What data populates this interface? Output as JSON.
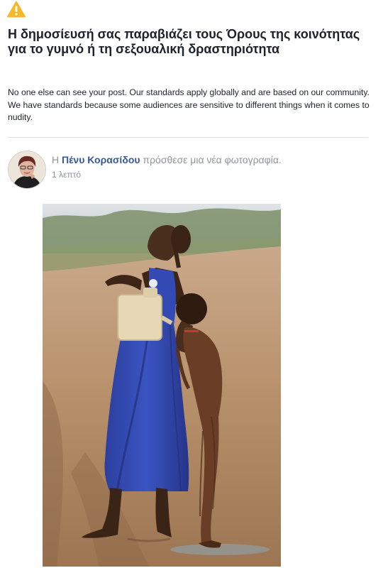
{
  "notice": {
    "icon": "warning-icon",
    "icon_color": "#f7b928",
    "title": "Η δημοσίευσή σας παραβιάζει τους Όρους της κοινότητας για το γυμνό ή τη σεξουαλική δραστηριότητα",
    "body": "No one else can see your post. Our standards apply globally and are based on our community. We have standards because some audiences are sensitive to different things when it comes to nudity."
  },
  "post": {
    "prefix": "Η ",
    "author": "Πένυ Κορασίδου",
    "action": " πρόσθεσε μια νέα φωτογραφία.",
    "time": "1 λεπτό",
    "link_color": "#365899"
  }
}
